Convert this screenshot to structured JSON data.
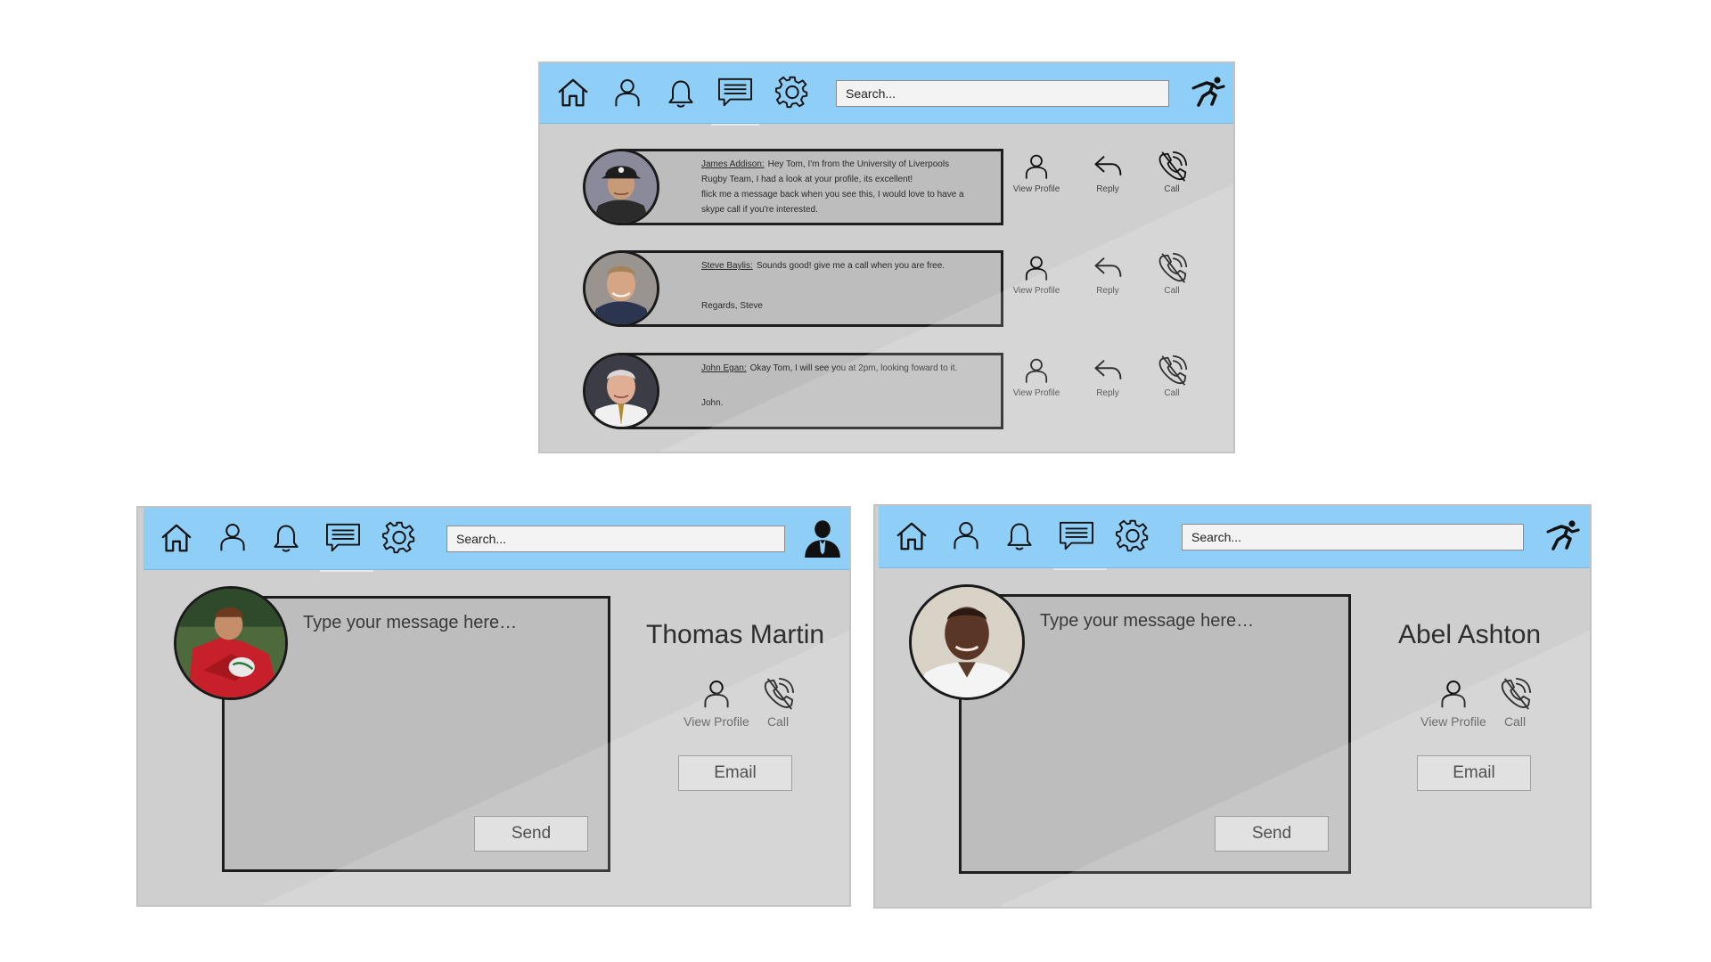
{
  "nav_icons": [
    "home-icon",
    "profile-icon",
    "bell-icon",
    "messages-icon",
    "gear-icon"
  ],
  "inbox": {
    "search": {
      "placeholder": "Search..."
    },
    "logo": "runner-logo-icon",
    "messages": [
      {
        "sender": "James Addison:",
        "lines": [
          "Hey Tom, I'm from the University of Liverpools",
          "Rugby Team, I had a look at your profile, its excellent!",
          "flick me a message back when you see this, I would love to have a",
          "skype call if you're interested."
        ],
        "signature": ""
      },
      {
        "sender": "Steve Baylis:",
        "lines": [
          "Sounds good! give me a call when you are free."
        ],
        "signature": "Regards, Steve"
      },
      {
        "sender": "John Egan:",
        "lines": [
          "Okay Tom, I will see you at 2pm, looking foward to it."
        ],
        "signature": "John."
      }
    ],
    "actions": {
      "view_profile": "View Profile",
      "reply": "Reply",
      "call": "Call"
    }
  },
  "compose_left": {
    "search": {
      "placeholder": "Search..."
    },
    "logo": "user-silhouette-icon",
    "message_placeholder": "Type your message here…",
    "send_label": "Send",
    "contact_name": "Thomas Martin",
    "view_profile_label": "View Profile",
    "call_label": "Call",
    "email_label": "Email"
  },
  "compose_right": {
    "search": {
      "placeholder": "Search..."
    },
    "logo": "runner-logo-icon",
    "message_placeholder": "Type your message here…",
    "send_label": "Send",
    "contact_name": "Abel Ashton",
    "view_profile_label": "View Profile",
    "call_label": "Call",
    "email_label": "Email"
  },
  "colors": {
    "navbar": "#8fcff7",
    "panel": "#cfcfcf",
    "message_box": "#bdbdbd",
    "border": "#1d1d1d"
  }
}
